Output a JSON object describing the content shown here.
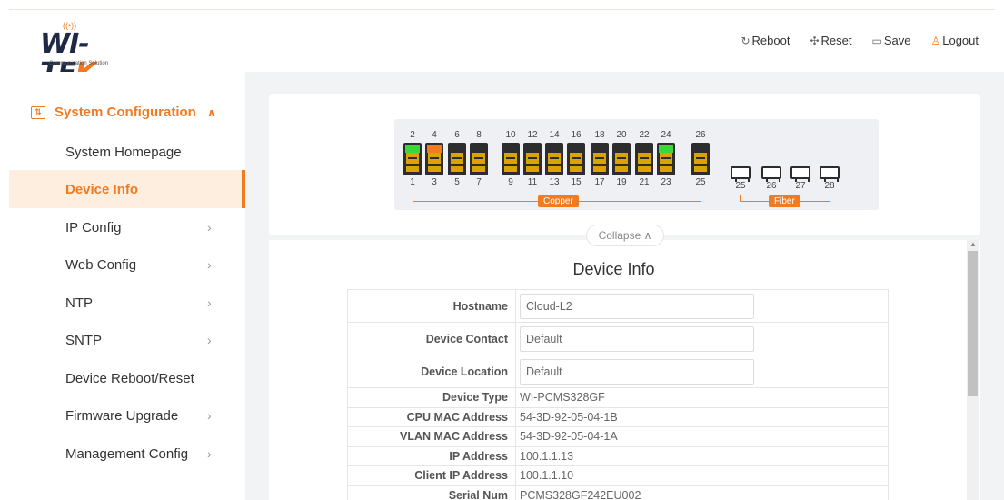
{
  "brand": {
    "logo_main": "WI-TE",
    "logo_accent": "K",
    "logo_sub": "Communication Solution"
  },
  "top_actions": {
    "reboot": "Reboot",
    "reset": "Reset",
    "save": "Save",
    "logout": "Logout"
  },
  "sidebar": {
    "section_title": "System Configuration",
    "items": [
      {
        "label": "System Homepage",
        "has_submenu": false,
        "active": false
      },
      {
        "label": "Device Info",
        "has_submenu": false,
        "active": true
      },
      {
        "label": "IP Config",
        "has_submenu": true,
        "active": false
      },
      {
        "label": "Web Config",
        "has_submenu": true,
        "active": false
      },
      {
        "label": "NTP",
        "has_submenu": true,
        "active": false
      },
      {
        "label": "SNTP",
        "has_submenu": true,
        "active": false
      },
      {
        "label": "Device Reboot/Reset",
        "has_submenu": false,
        "active": false
      },
      {
        "label": "Firmware Upgrade",
        "has_submenu": true,
        "active": false
      },
      {
        "label": "Management Config",
        "has_submenu": true,
        "active": false
      }
    ]
  },
  "panel": {
    "top_numbers": [
      "2",
      "4",
      "6",
      "8",
      "10",
      "12",
      "14",
      "16",
      "18",
      "20",
      "22",
      "24",
      "26"
    ],
    "bottom_numbers": [
      "1",
      "3",
      "5",
      "7",
      "9",
      "11",
      "13",
      "15",
      "17",
      "19",
      "21",
      "23",
      "25"
    ],
    "fiber_numbers": [
      "25",
      "26",
      "27",
      "28"
    ],
    "copper_label": "Copper",
    "fiber_label": "Fiber",
    "port_status": {
      "2": "green",
      "4": "orange",
      "24": "green"
    }
  },
  "collapse_label": "Collapse",
  "device_info": {
    "title": "Device Info",
    "editable": [
      {
        "label": "Hostname",
        "value": "Cloud-L2"
      },
      {
        "label": "Device Contact",
        "value": "Default"
      },
      {
        "label": "Device Location",
        "value": "Default"
      }
    ],
    "readonly": [
      {
        "label": "Device Type",
        "value": "WI-PCMS328GF"
      },
      {
        "label": "CPU MAC Address",
        "value": "54-3D-92-05-04-1B"
      },
      {
        "label": "VLAN MAC Address",
        "value": "54-3D-92-05-04-1A"
      },
      {
        "label": "IP Address",
        "value": "100.1.1.13"
      },
      {
        "label": "Client IP Address",
        "value": "100.1.1.10"
      },
      {
        "label": "Serial Num",
        "value": "PCMS328GF242EU002"
      }
    ]
  },
  "colors": {
    "accent": "#f07b20",
    "link_up": "#3ad63a"
  }
}
